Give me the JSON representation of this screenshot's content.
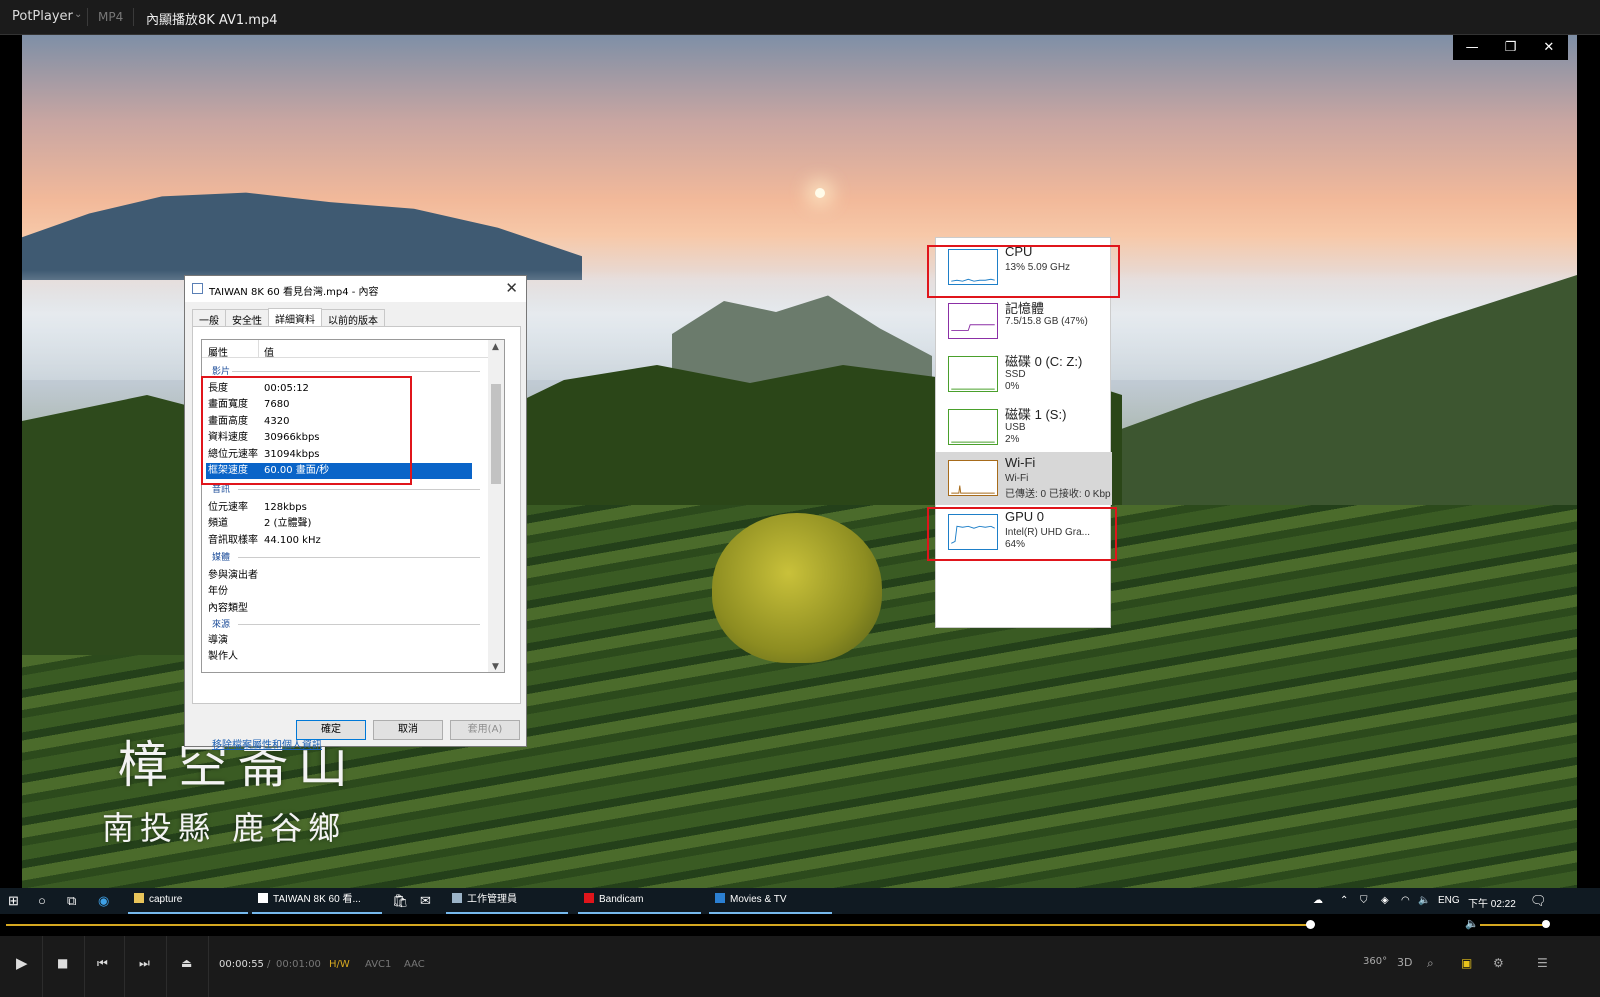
{
  "titlebar": {
    "app": "PotPlayer",
    "format": "MP4",
    "filename": "內顯播放8K AV1.mp4"
  },
  "video": {
    "caption_line1": "樟空崙山",
    "caption_line2": "南投縣 鹿谷鄉"
  },
  "window_controls": {
    "minimize": "—",
    "restore": "❐",
    "close": "✕"
  },
  "dialog": {
    "title": "TAIWAN 8K 60 看見台灣.mp4 - 內容",
    "tabs": [
      "一般",
      "安全性",
      "詳細資料",
      "以前的版本"
    ],
    "col_property": "屬性",
    "col_value": "值",
    "sections": {
      "video": "影片",
      "audio": "音訊",
      "media": "媒體",
      "origin": "來源"
    },
    "rows_video": [
      {
        "k": "長度",
        "v": "00:05:12"
      },
      {
        "k": "畫面寬度",
        "v": "7680"
      },
      {
        "k": "畫面高度",
        "v": "4320"
      },
      {
        "k": "資料速度",
        "v": "30966kbps"
      },
      {
        "k": "總位元速率",
        "v": "31094kbps"
      },
      {
        "k": "框架速度",
        "v": "60.00 畫面/秒"
      }
    ],
    "rows_audio": [
      {
        "k": "位元速率",
        "v": "128kbps"
      },
      {
        "k": "頻道",
        "v": "2 (立體聲)"
      },
      {
        "k": "音訊取樣率",
        "v": "44.100 kHz"
      }
    ],
    "rows_media": [
      {
        "k": "參與演出者",
        "v": ""
      },
      {
        "k": "年份",
        "v": ""
      },
      {
        "k": "內容類型",
        "v": ""
      }
    ],
    "rows_origin": [
      {
        "k": "導演",
        "v": ""
      },
      {
        "k": "製作人",
        "v": ""
      }
    ],
    "link": "移除檔案屬性和個人資訊",
    "ok": "確定",
    "cancel": "取消",
    "apply": "套用(A)"
  },
  "taskmgr": {
    "items": [
      {
        "name": "CPU",
        "s1": "13% 5.09 GHz",
        "s2": "",
        "color": "#1e7fc8"
      },
      {
        "name": "記憶體",
        "s1": "7.5/15.8 GB (47%)",
        "s2": "",
        "color": "#8b2fa6"
      },
      {
        "name": "磁碟 0 (C: Z:)",
        "s1": "SSD",
        "s2": "0%",
        "color": "#4aa02c"
      },
      {
        "name": "磁碟 1 (S:)",
        "s1": "USB",
        "s2": "2%",
        "color": "#4aa02c"
      },
      {
        "name": "Wi-Fi",
        "s1": "Wi-Fi",
        "s2": "已傳送: 0 已接收: 0 Kbp",
        "color": "#a76b1a"
      },
      {
        "name": "GPU 0",
        "s1": "Intel(R) UHD Gra...",
        "s2": "64%",
        "color": "#1e7fc8"
      }
    ]
  },
  "taskbar": {
    "tasks": [
      "capture",
      "TAIWAN 8K 60 看...",
      "工作管理員",
      "Bandicam",
      "Movies & TV"
    ],
    "lang": "ENG",
    "clock": "下午 02:22"
  },
  "player": {
    "seek_progress": 0.815,
    "volume": 0.96,
    "time_current": "00:00:55",
    "time_sep": "/",
    "time_total": "00:01:00",
    "badges": [
      "H/W",
      "AVC1",
      "AAC"
    ],
    "right": [
      "360°",
      "3D"
    ]
  }
}
